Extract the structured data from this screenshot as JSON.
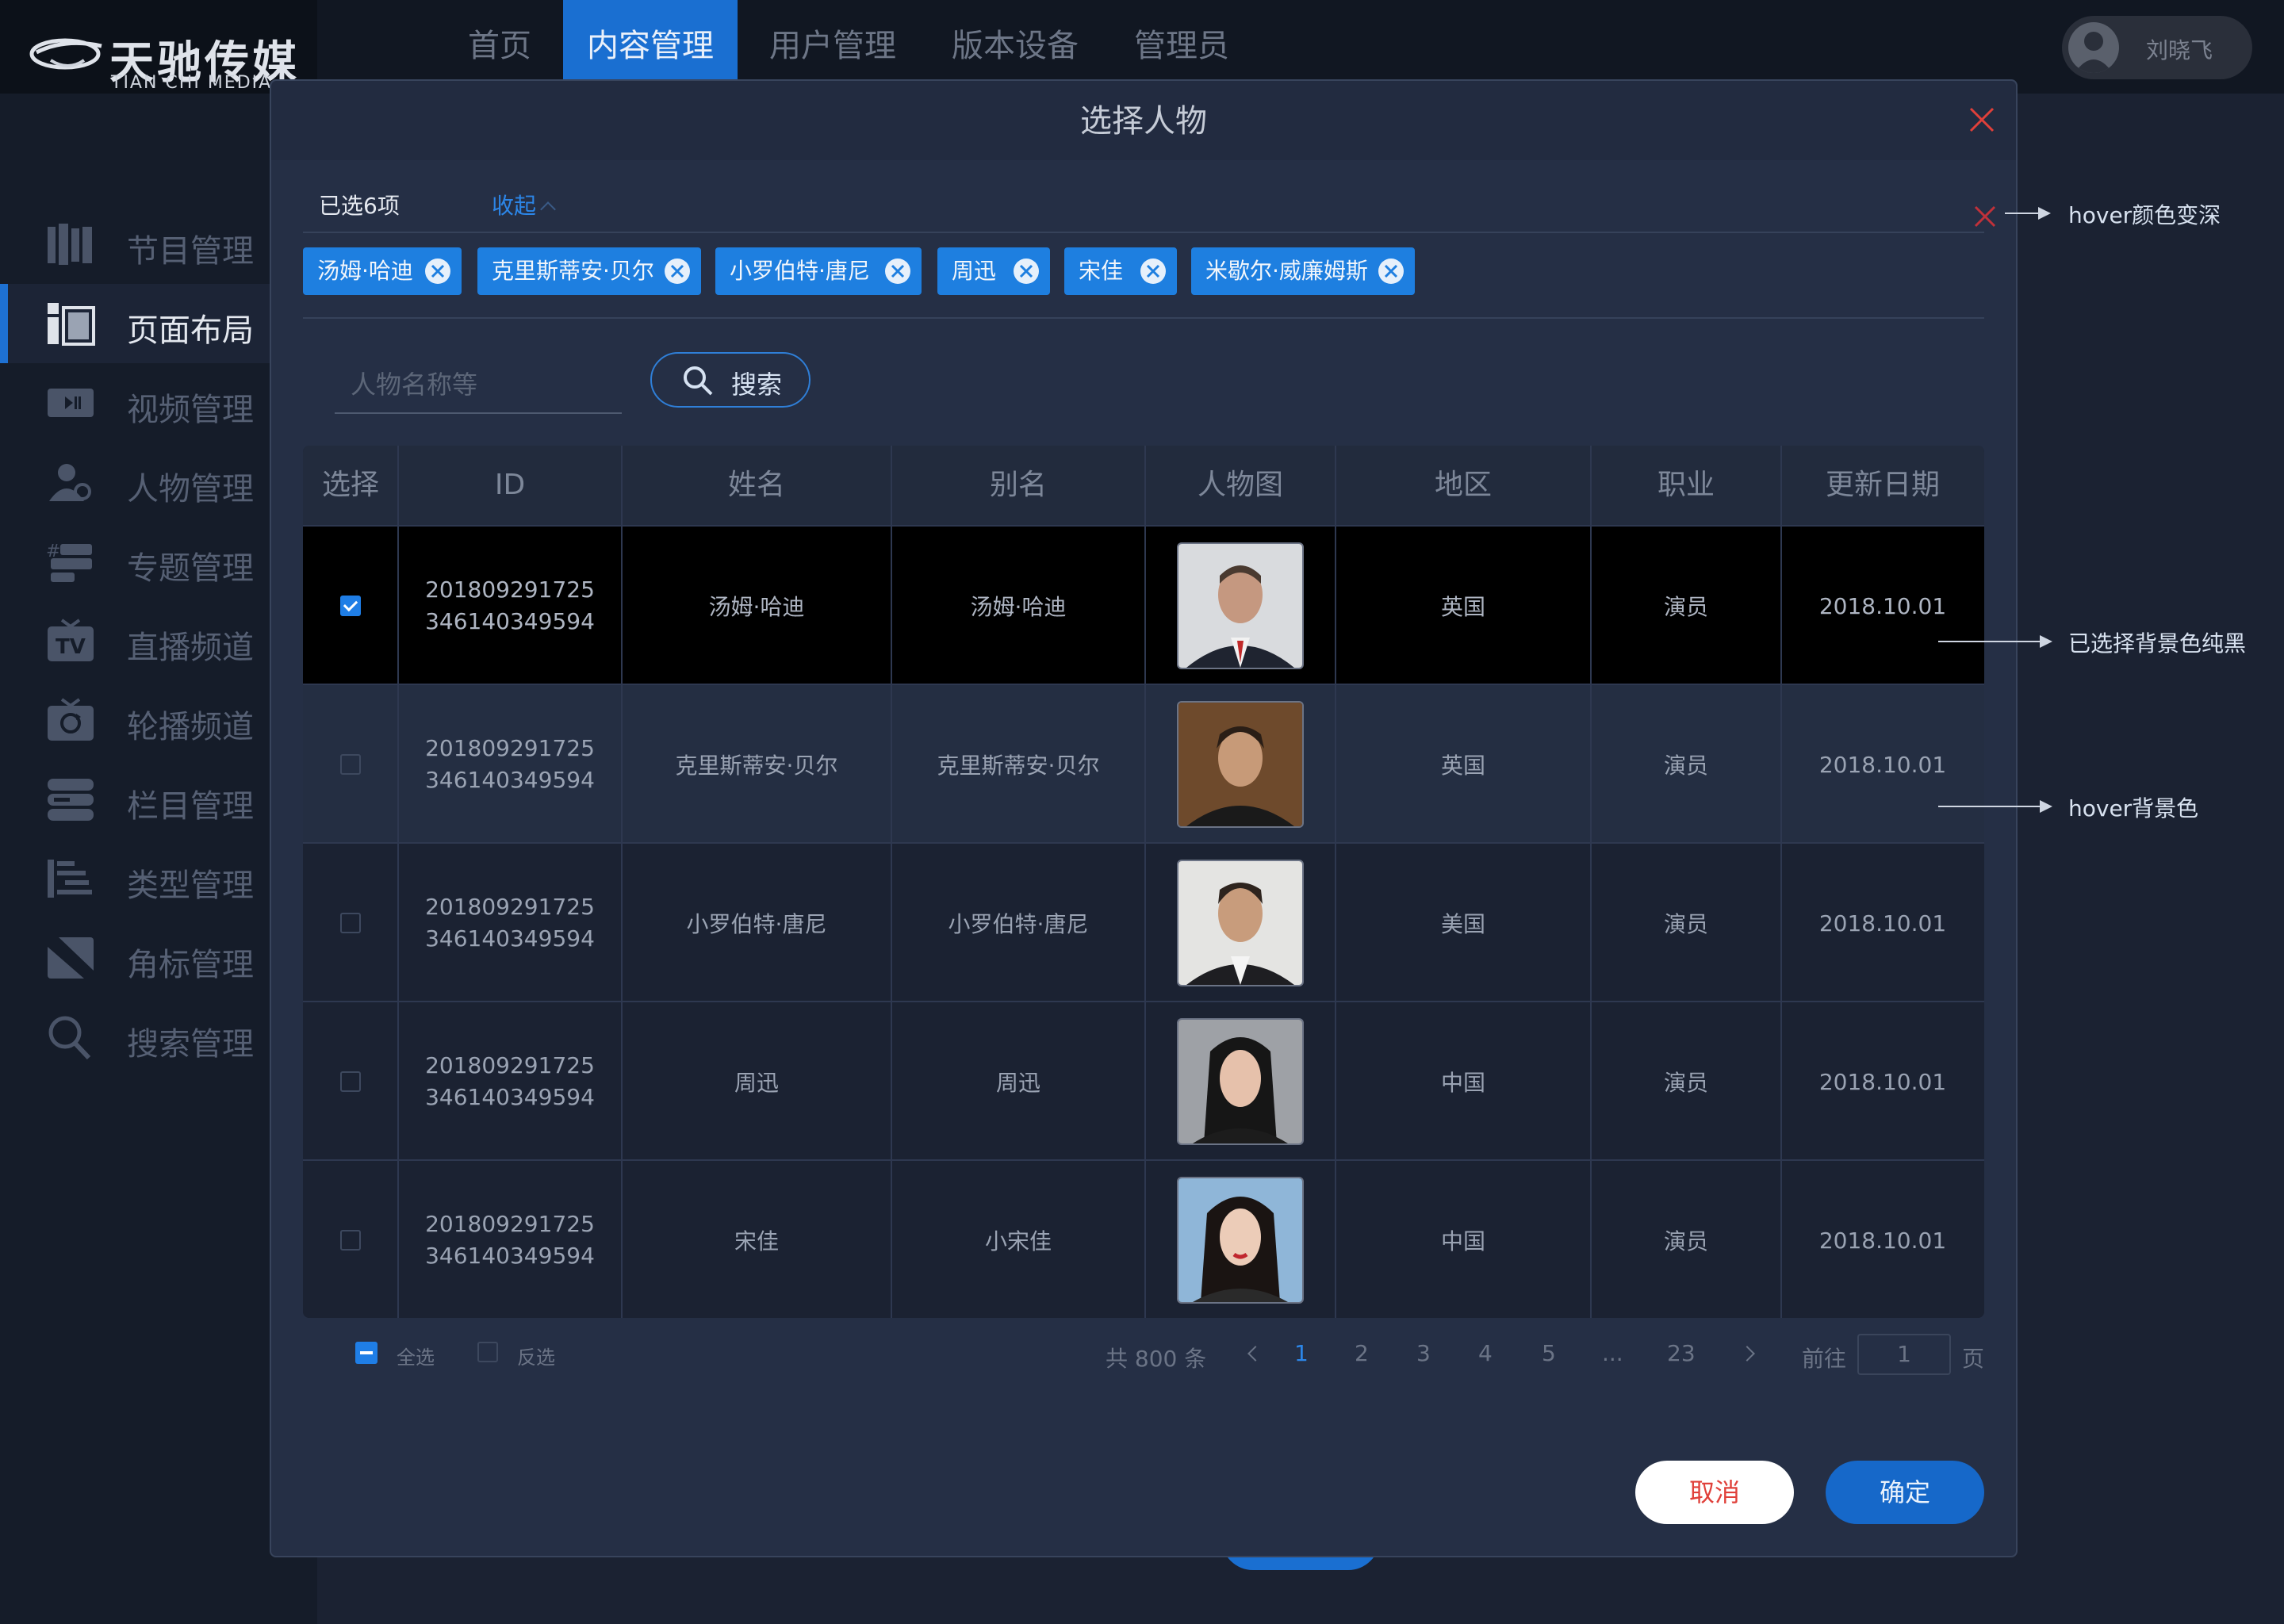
{
  "brand": {
    "name_cn": "天驰传媒",
    "name_en": "TIAN CHI MEDIA"
  },
  "top_nav": [
    {
      "label": "首页"
    },
    {
      "label": "内容管理",
      "active": true
    },
    {
      "label": "用户管理"
    },
    {
      "label": "版本设备"
    },
    {
      "label": "管理员"
    }
  ],
  "user": {
    "name": "刘晓飞"
  },
  "sidebar": [
    {
      "label": "节目管理",
      "icon": "program-icon"
    },
    {
      "label": "页面布局",
      "icon": "layout-icon",
      "active": true
    },
    {
      "label": "视频管理",
      "icon": "video-icon"
    },
    {
      "label": "人物管理",
      "icon": "person-icon"
    },
    {
      "label": "专题管理",
      "icon": "topic-icon"
    },
    {
      "label": "直播频道",
      "icon": "tv-icon"
    },
    {
      "label": "轮播频道",
      "icon": "carousel-icon"
    },
    {
      "label": "栏目管理",
      "icon": "column-icon"
    },
    {
      "label": "类型管理",
      "icon": "type-icon"
    },
    {
      "label": "角标管理",
      "icon": "badge-icon"
    },
    {
      "label": "搜索管理",
      "icon": "search-icon"
    }
  ],
  "modal": {
    "title": "选择人物",
    "selected_count": "已选6项",
    "collapse_label": "收起",
    "tags": [
      "汤姆·哈迪",
      "克里斯蒂安·贝尔",
      "小罗伯特·唐尼",
      "周迅",
      "宋佳",
      "米歇尔·威廉姆斯"
    ],
    "search": {
      "placeholder": "人物名称等",
      "button_label": "搜索"
    },
    "table": {
      "headers": [
        "选择",
        "ID",
        "姓名",
        "别名",
        "人物图",
        "地区",
        "职业",
        "更新日期"
      ],
      "rows": [
        {
          "checked": true,
          "state": "selected",
          "id_line1": "201809291725",
          "id_line2": "346140349594",
          "name": "汤姆·哈迪",
          "alias": "汤姆·哈迪",
          "region": "英国",
          "job": "演员",
          "date": "2018.10.01"
        },
        {
          "checked": false,
          "state": "hover",
          "id_line1": "201809291725",
          "id_line2": "346140349594",
          "name": "克里斯蒂安·贝尔",
          "alias": "克里斯蒂安·贝尔",
          "region": "英国",
          "job": "演员",
          "date": "2018.10.01"
        },
        {
          "checked": false,
          "state": "normal",
          "id_line1": "201809291725",
          "id_line2": "346140349594",
          "name": "小罗伯特·唐尼",
          "alias": "小罗伯特·唐尼",
          "region": "美国",
          "job": "演员",
          "date": "2018.10.01"
        },
        {
          "checked": false,
          "state": "normal",
          "id_line1": "201809291725",
          "id_line2": "346140349594",
          "name": "周迅",
          "alias": "周迅",
          "region": "中国",
          "job": "演员",
          "date": "2018.10.01"
        },
        {
          "checked": false,
          "state": "normal",
          "id_line1": "201809291725",
          "id_line2": "346140349594",
          "name": "宋佳",
          "alias": "小宋佳",
          "region": "中国",
          "job": "演员",
          "date": "2018.10.01"
        }
      ]
    },
    "footer": {
      "select_all": "全选",
      "invert": "反选",
      "total": "共 800 条",
      "pages": [
        "1",
        "2",
        "3",
        "4",
        "5",
        "...",
        "23"
      ],
      "current_page": "1",
      "goto_label": "前往",
      "goto_value": "1",
      "goto_unit": "页"
    },
    "cancel_label": "取消",
    "ok_label": "确定"
  },
  "annotations": {
    "hover_close": "hover颜色变深",
    "selected_bg": "已选择背景色纯黑",
    "hover_bg": "hover背景色"
  },
  "colors": {
    "accent": "#1e7fe0",
    "danger": "#e0403a",
    "selected_row": "#000000",
    "hover_row": "#242e42"
  }
}
